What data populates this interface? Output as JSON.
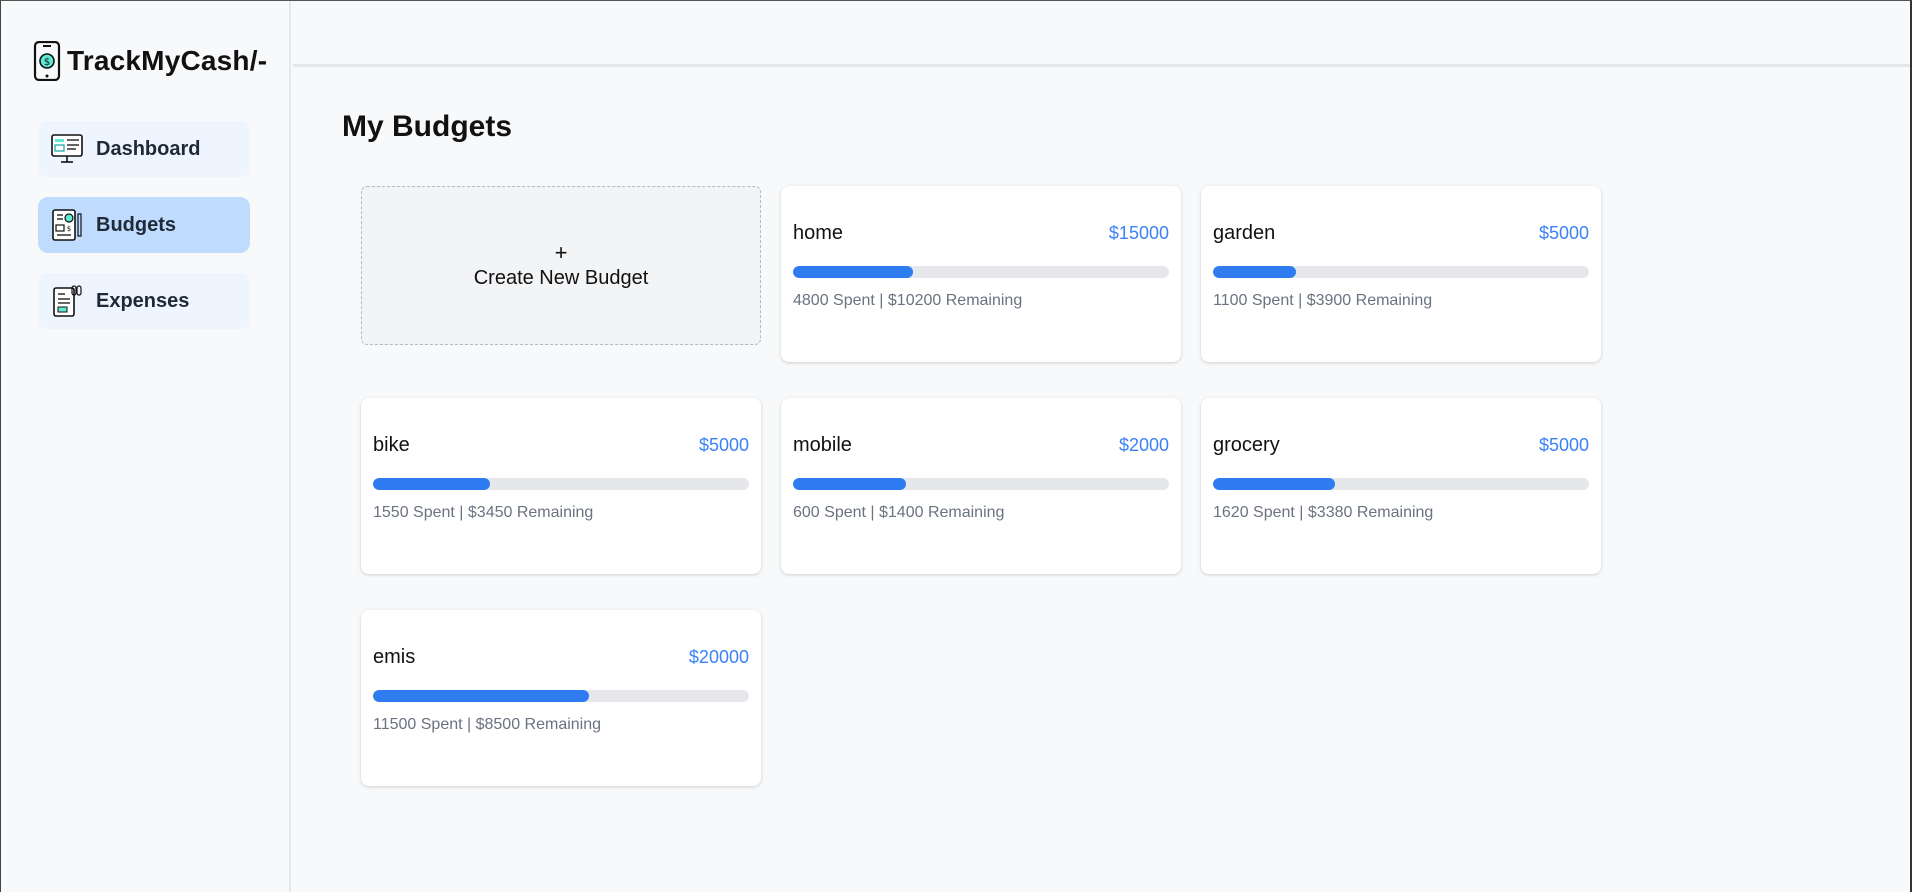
{
  "app": {
    "name": "TrackMyCash/-"
  },
  "sidebar": {
    "items": [
      {
        "label": "Dashboard",
        "icon": "dashboard-icon",
        "active": false
      },
      {
        "label": "Budgets",
        "icon": "budget-icon",
        "active": true
      },
      {
        "label": "Expenses",
        "icon": "expenses-icon",
        "active": false
      }
    ]
  },
  "main": {
    "title": "My Budgets",
    "create": {
      "plus": "+",
      "label": "Create New Budget"
    },
    "budgets": [
      {
        "name": "home",
        "amount": "$15000",
        "spent_pct": 32,
        "info": "4800 Spent | $10200 Remaining"
      },
      {
        "name": "garden",
        "amount": "$5000",
        "spent_pct": 22,
        "info": "1100 Spent | $3900 Remaining"
      },
      {
        "name": "bike",
        "amount": "$5000",
        "spent_pct": 31,
        "info": "1550 Spent | $3450 Remaining"
      },
      {
        "name": "mobile",
        "amount": "$2000",
        "spent_pct": 30,
        "info": "600 Spent | $1400 Remaining"
      },
      {
        "name": "grocery",
        "amount": "$5000",
        "spent_pct": 32.4,
        "info": "1620 Spent | $3380 Remaining"
      },
      {
        "name": "emis",
        "amount": "$20000",
        "spent_pct": 57.5,
        "info": "11500 Spent | $8500 Remaining"
      }
    ]
  },
  "colors": {
    "accent": "#3b82f6",
    "active_nav": "#bfdbfe",
    "nav_bg": "#eef5ff"
  }
}
